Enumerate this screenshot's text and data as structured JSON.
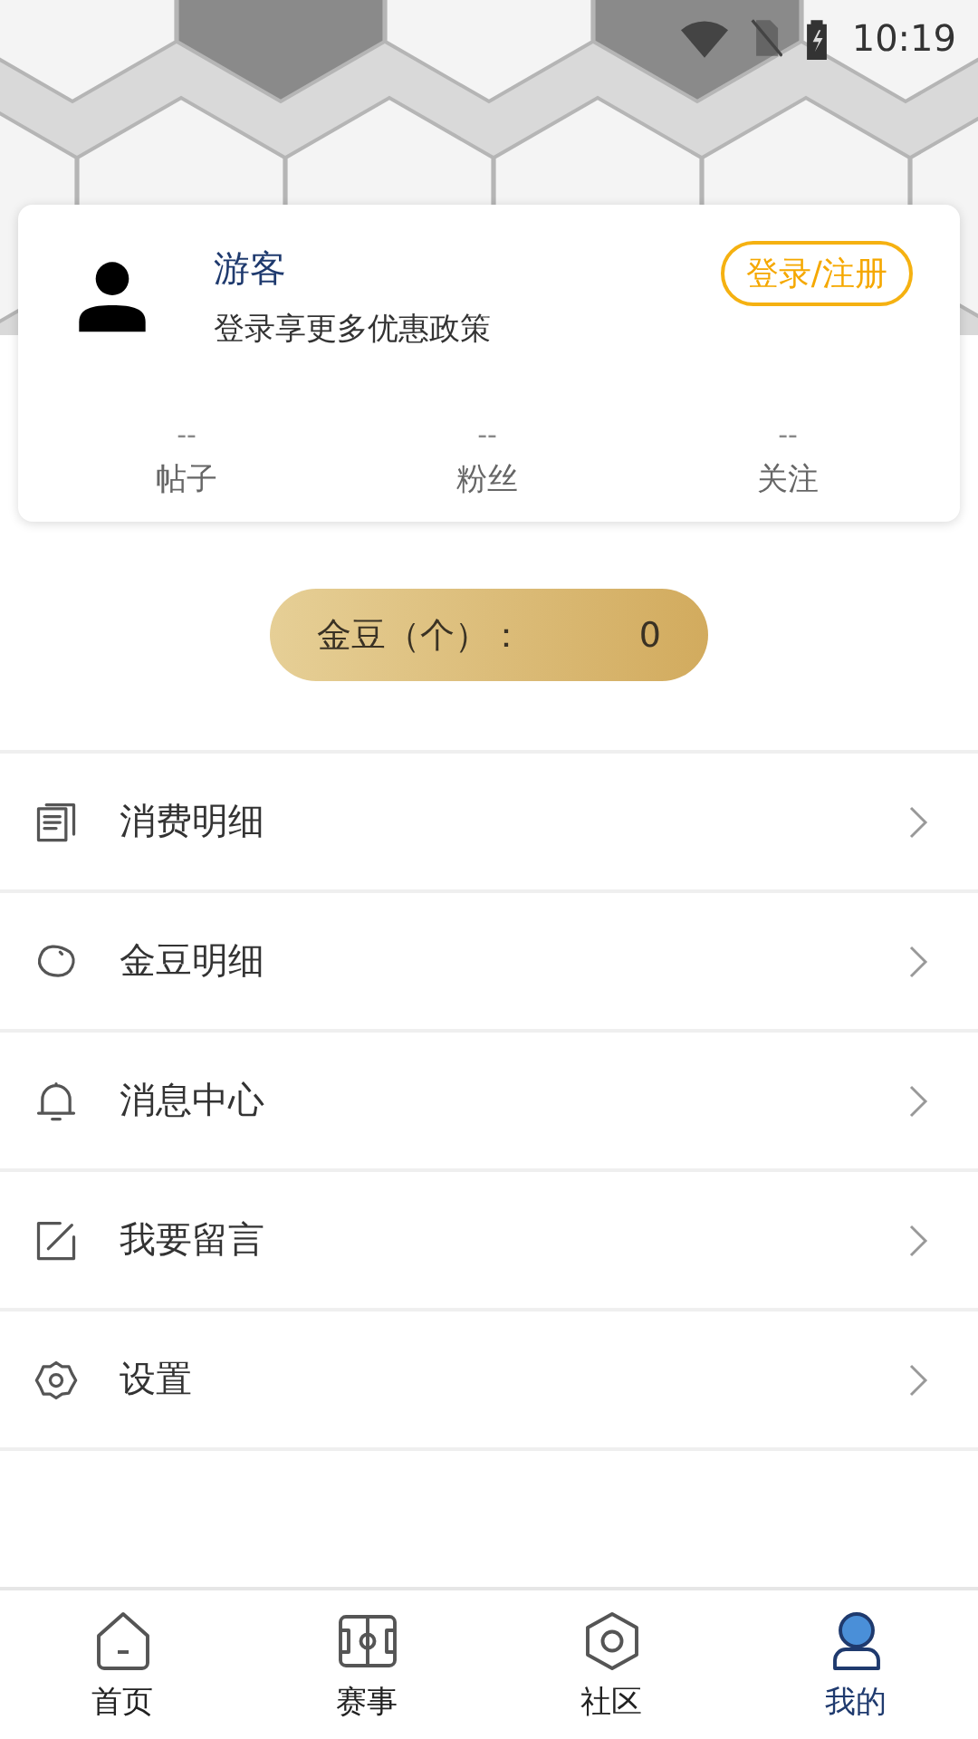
{
  "status_bar": {
    "time": "10:19"
  },
  "profile": {
    "name": "游客",
    "subtitle": "登录享更多优惠政策",
    "login_button": "登录/注册",
    "stats": [
      {
        "value": "--",
        "label": "帖子"
      },
      {
        "value": "--",
        "label": "粉丝"
      },
      {
        "value": "--",
        "label": "关注"
      }
    ]
  },
  "gold_beans": {
    "label": "金豆（个）：",
    "value": "0"
  },
  "menu": [
    {
      "kind": "receipt",
      "label": "消费明细"
    },
    {
      "kind": "bean",
      "label": "金豆明细"
    },
    {
      "kind": "bell",
      "label": "消息中心"
    },
    {
      "kind": "edit",
      "label": "我要留言"
    },
    {
      "kind": "settings",
      "label": "设置"
    }
  ],
  "tab_bar": [
    {
      "kind": "home",
      "label": "首页",
      "selected": false
    },
    {
      "kind": "pitch",
      "label": "赛事",
      "selected": false
    },
    {
      "kind": "community",
      "label": "社区",
      "selected": false
    },
    {
      "kind": "profile",
      "label": "我的",
      "selected": true
    }
  ]
}
